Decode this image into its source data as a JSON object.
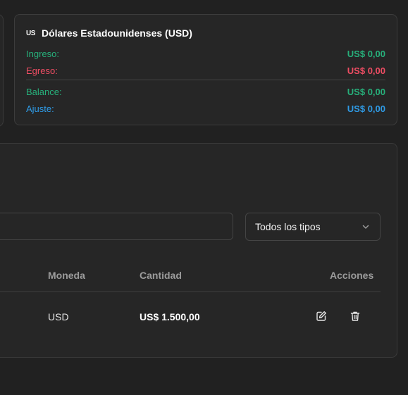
{
  "summary_card": {
    "flag_code": "US",
    "title": "Dólares Estadounidenses (USD)",
    "rows": [
      {
        "label": "Ingreso:",
        "value": "US$ 0,00"
      },
      {
        "label": "Egreso:",
        "value": "US$ 0,00"
      },
      {
        "label": "Balance:",
        "value": "US$ 0,00"
      },
      {
        "label": "Ajuste:",
        "value": "US$ 0,00"
      }
    ],
    "colors": {
      "ingreso": "#27b07b",
      "egreso": "#ee4d63",
      "balance": "#27b07b",
      "ajuste": "#2f9be6"
    }
  },
  "filters": {
    "search_placeholder": "",
    "type_select": {
      "selected": "Todos los tipos",
      "icon": "chevron-down-icon"
    }
  },
  "table": {
    "headers": {
      "moneda": "Moneda",
      "cantidad": "Cantidad",
      "acciones": "Acciones"
    },
    "rows": [
      {
        "moneda": "USD",
        "cantidad": "US$ 1.500,00",
        "actions": [
          "edit-icon",
          "trash-icon"
        ]
      }
    ]
  }
}
